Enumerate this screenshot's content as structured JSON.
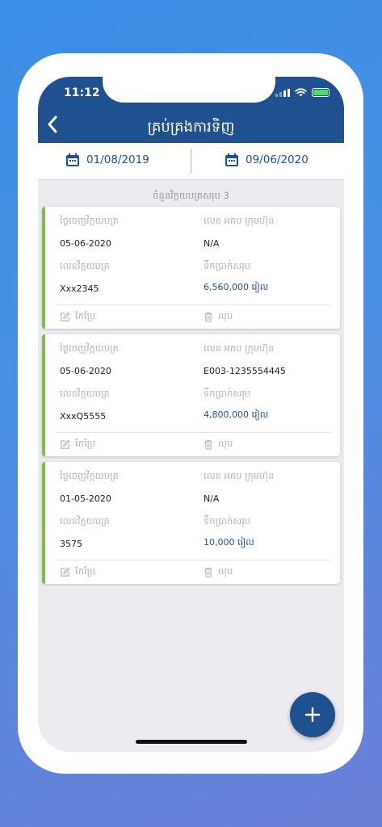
{
  "status": {
    "time": "11:12"
  },
  "header": {
    "title": "គ្រប់គ្រងការទិញ"
  },
  "date_filter": {
    "from": "01/08/2019",
    "to": "09/06/2020"
  },
  "summary": {
    "total_label": "ចំនួនវិក្កយបត្រសរុប 3"
  },
  "labels": {
    "invoice_date": "ថ្ងៃចេញវិក្កយបត្រ",
    "company_vat": "លេខ អតប ក្រុមហ៊ុន",
    "invoice_no": "លេខវិក្កយបត្រ",
    "total_amount": "ទឹកប្រាក់សរុប",
    "edit": "កែប្រែ",
    "delete": "លុប"
  },
  "invoices": [
    {
      "date": "05-06-2020",
      "vat": "N/A",
      "number": "Xxx2345",
      "amount": "6,560,000 រៀល"
    },
    {
      "date": "05-06-2020",
      "vat": "E003-1235554445",
      "number": "XxxQ5555",
      "amount": "4,800,000 រៀល"
    },
    {
      "date": "01-05-2020",
      "vat": "N/A",
      "number": "3575",
      "amount": "10,000 រៀល"
    }
  ],
  "colors": {
    "primary": "#1f508f",
    "accent_green": "#7bbf4a",
    "background": "#ebebf0"
  },
  "icons": {
    "back": "chevron-left-icon",
    "calendar": "calendar-icon",
    "edit": "edit-icon",
    "delete": "trash-icon",
    "add": "plus-icon"
  }
}
